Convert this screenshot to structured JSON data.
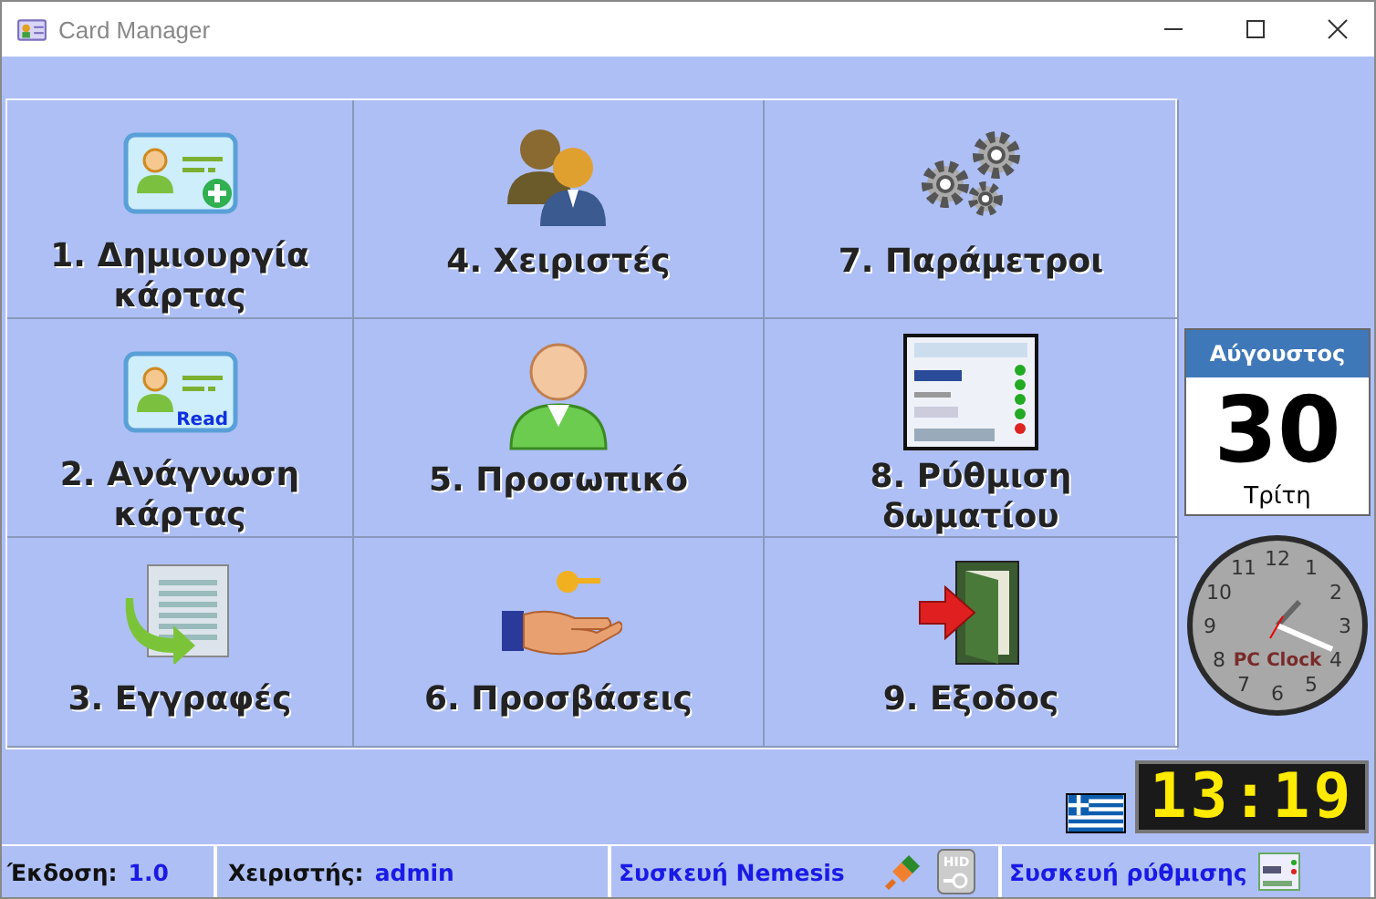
{
  "window": {
    "title": "Card Manager"
  },
  "tiles": [
    {
      "kind": "card_add",
      "label": "1. Δημιουργία κάρτας"
    },
    {
      "kind": "card_read",
      "label": "2. Ανάγνωση κάρτας",
      "icon_text": "Read"
    },
    {
      "kind": "records",
      "label": "3. Εγγραφές"
    },
    {
      "kind": "users",
      "label": "4. Χειριστές"
    },
    {
      "kind": "person",
      "label": "5. Προσωπικό"
    },
    {
      "kind": "keys",
      "label": "6. Προσβάσεις"
    },
    {
      "kind": "gears",
      "label": "7. Παράμετροι"
    },
    {
      "kind": "room_panel",
      "label": "8. Ρύθμιση δωματίου"
    },
    {
      "kind": "exit",
      "label": "9. Εξοδος"
    }
  ],
  "calendar": {
    "month": "Αύγουστος",
    "day": "30",
    "weekday": "Τρίτη"
  },
  "clock": {
    "label": "PC Clock",
    "numerals": [
      "11",
      "12",
      "1",
      "10",
      "2",
      "9",
      "3",
      "8",
      "4",
      "7",
      "6",
      "5"
    ]
  },
  "led_time": "13:19",
  "status_bar": {
    "version_label": "Έκδοση:",
    "version": "1.0",
    "operator_label": "Χειριστής:",
    "operator": "admin",
    "device": "Συσκευή Nemesis",
    "hid_label": "HID",
    "setup_device": "Συσκευή ρύθμισης"
  }
}
